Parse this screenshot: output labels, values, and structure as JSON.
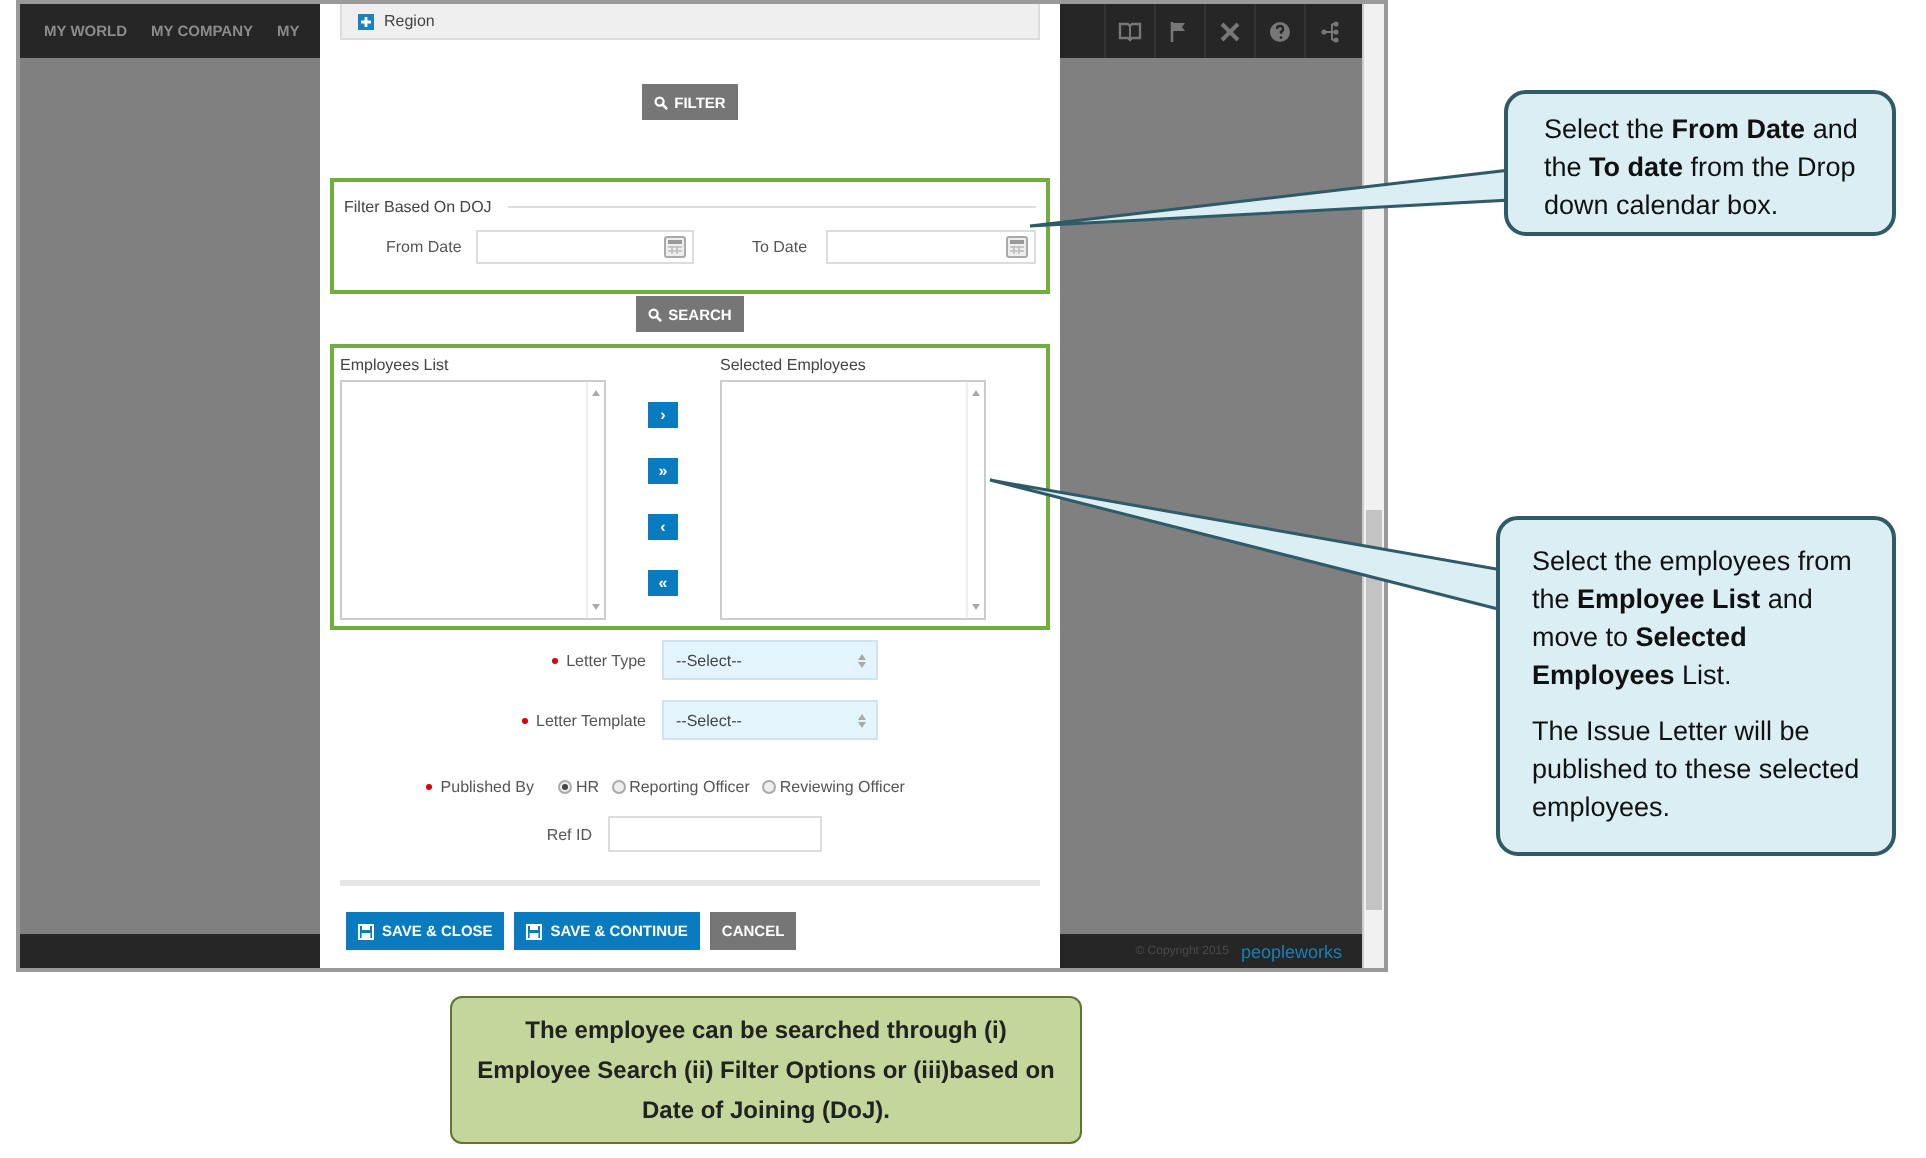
{
  "nav": {
    "items": [
      "MY WORLD",
      "MY COMPANY",
      "MY"
    ]
  },
  "region": {
    "label": "Region"
  },
  "filter_button": {
    "label": "FILTER"
  },
  "doj_filter": {
    "legend": "Filter Based On DOJ",
    "fields": [
      {
        "label": "From Date"
      },
      {
        "label": "To Date"
      }
    ]
  },
  "search_button": {
    "label": "SEARCH"
  },
  "employees": {
    "lists": [
      {
        "label": "Employees List"
      },
      {
        "label": "Selected Employees"
      }
    ],
    "move_buttons": [
      "›",
      "»",
      "‹",
      "«"
    ]
  },
  "form": [
    {
      "kind": "select",
      "label": "Letter Type",
      "required": true,
      "value": "--Select--"
    },
    {
      "kind": "select",
      "label": "Letter Template",
      "required": true,
      "value": "--Select--"
    },
    {
      "kind": "radio",
      "label": "Published By",
      "required": true,
      "options": [
        {
          "label": "HR",
          "selected": true
        },
        {
          "label": "Reporting Officer",
          "selected": false
        },
        {
          "label": "Reviewing Officer",
          "selected": false
        }
      ]
    },
    {
      "kind": "text",
      "label": "Ref ID",
      "required": false
    }
  ],
  "actions": [
    {
      "label": "SAVE & CLOSE",
      "kind": "primary"
    },
    {
      "label": "SAVE & CONTINUE",
      "kind": "primary"
    },
    {
      "label": "CANCEL",
      "kind": "secondary"
    }
  ],
  "footer": {
    "copyright": "© Copyright 2015",
    "brand": "peopleworks"
  },
  "callouts": [
    {
      "paragraphs": [
        "Select the **From Date** and the **To date** from the Drop down calendar box."
      ]
    },
    {
      "paragraphs": [
        "Select the employees from the **Employee List** and move to **Selected Employees** List.",
        "The Issue Letter will be published to these selected employees."
      ]
    }
  ],
  "note": "The employee can be searched through (i) Employee Search (ii) Filter Options or (iii)based on Date of Joining (DoJ)."
}
